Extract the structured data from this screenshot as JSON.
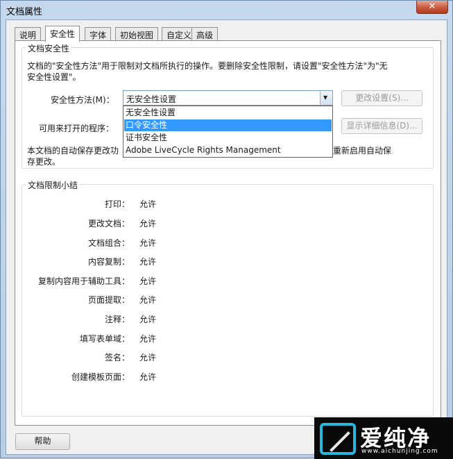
{
  "window": {
    "title": "文档属性",
    "close_glyph": "✕"
  },
  "tabs": [
    {
      "label": "说明"
    },
    {
      "label": "安全性"
    },
    {
      "label": "字体"
    },
    {
      "label": "初始视图"
    },
    {
      "label": "自定义"
    },
    {
      "label": "高级"
    }
  ],
  "security": {
    "group_title": "文档安全性",
    "desc_line1": "文档的\"安全性方法\"用于限制对文档所执行的操作。要删除安全性限制，请设置\"安全性方法\"为\"无",
    "desc_line2": "安全性设置\"。",
    "method_label": "安全性方法(M)：",
    "method_value": "无安全性设置",
    "change_settings_button": "更改设置(S)...",
    "open_with_label": "可用来打开的程序：",
    "show_details_button": "显示详细信息(D)...",
    "autosave_line1": "本文档的自动保存更改功",
    "autosave_line1_right": "重新启用自动保",
    "autosave_line2": "存更改。",
    "dropdown_options": [
      "无安全性设置",
      "口令安全性",
      "证书安全性",
      "Adobe LiveCycle Rights Management"
    ],
    "dropdown_selected_index": 1
  },
  "restrictions": {
    "group_title": "文档限制小结",
    "rows": [
      {
        "label": "打印：",
        "value": "允许"
      },
      {
        "label": "更改文档：",
        "value": "允许"
      },
      {
        "label": "文档组合：",
        "value": "允许"
      },
      {
        "label": "内容复制：",
        "value": "允许"
      },
      {
        "label": "复制内容用于辅助工具：",
        "value": "允许"
      },
      {
        "label": "页面提取：",
        "value": "允许"
      },
      {
        "label": "注释：",
        "value": "允许"
      },
      {
        "label": "填写表单域：",
        "value": "允许"
      },
      {
        "label": "签名：",
        "value": "允许"
      },
      {
        "label": "创建模板页面：",
        "value": "允许"
      }
    ]
  },
  "footer": {
    "help_button": "帮助"
  },
  "watermark": {
    "text": "爱纯净",
    "url": "www.aichunjing.com"
  }
}
